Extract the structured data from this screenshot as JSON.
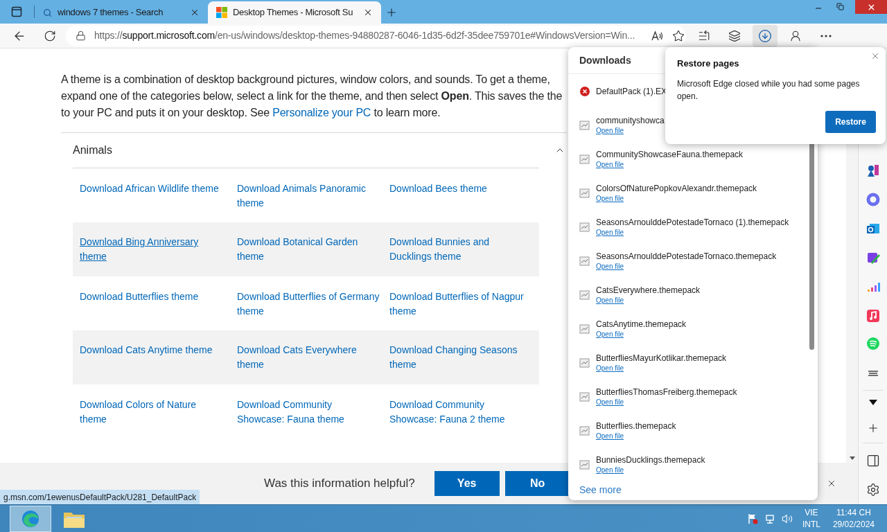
{
  "tabs": [
    {
      "title": "windows 7 themes - Search",
      "kind": "search",
      "selected": false
    },
    {
      "title": "Desktop Themes - Microsoft Su",
      "kind": "site",
      "selected": true
    }
  ],
  "address": {
    "scheme": "https://",
    "host": "support.microsoft.com",
    "path": "/en-us/windows/desktop-themes-94880287-6046-1d35-6d2f-35dee759701e#WindowsVersion=Win..."
  },
  "toolbar_buttons": [
    {
      "kind": "favorites",
      "selected": false
    },
    {
      "kind": "collections",
      "selected": false
    },
    {
      "kind": "downloads",
      "selected": true
    },
    {
      "kind": "profile",
      "selected": false
    },
    {
      "kind": "more",
      "selected": false
    }
  ],
  "intro": {
    "line_1": "A theme is a combination of desktop background pictures, window colors, and sounds. To get a theme,",
    "line_2": "expand one of the categories below, select a link for the theme, and then select **Open**. This saves the the",
    "line_3_start": "to your PC and puts it on your desktop. See",
    "link": "Personalize your PC",
    "line_3_end": "to learn more."
  },
  "category": {
    "title": "Animals",
    "expanded": true
  },
  "link_rows": [
    {
      "shaded": false,
      "links": [
        {
          "text": "Download African Wildlife theme",
          "hovered": false
        },
        {
          "text": "Download Animals Panoramic theme",
          "hovered": false
        },
        {
          "text": "Download Bees theme",
          "hovered": false
        }
      ]
    },
    {
      "shaded": true,
      "links": [
        {
          "text": "Download Bing Anniversary theme",
          "hovered": true
        },
        {
          "text": "Download Botanical Garden theme",
          "hovered": false
        },
        {
          "text": "Download Bunnies and Ducklings theme",
          "hovered": false
        }
      ]
    },
    {
      "shaded": false,
      "links": [
        {
          "text": "Download Butterflies theme",
          "hovered": false
        },
        {
          "text": "Download Butterflies of Germany theme",
          "hovered": false
        },
        {
          "text": "Download Butterflies of Nagpur theme",
          "hovered": false
        }
      ]
    },
    {
      "shaded": true,
      "links": [
        {
          "text": "Download Cats Anytime theme",
          "hovered": false
        },
        {
          "text": "Download Cats Everywhere theme",
          "hovered": false
        },
        {
          "text": "Download Changing Seasons theme",
          "hovered": false
        }
      ]
    },
    {
      "shaded": false,
      "links": [
        {
          "text": "Download Colors of Nature theme",
          "hovered": false
        },
        {
          "text": "Download Community Showcase: Fauna theme",
          "hovered": false
        },
        {
          "text": "Download Community Showcase: Fauna 2 theme",
          "hovered": false
        }
      ]
    }
  ],
  "feedback": {
    "question": "Was this information helpful?",
    "buttons": [
      "Yes",
      "No"
    ]
  },
  "status_url": "g.msn.com/1ewenusDefaultPack/U281_DefaultPack",
  "downloads": {
    "title": "Downloads",
    "items": [
      {
        "name": "DefaultPack (1).EX",
        "kind": "failed"
      },
      {
        "name": "communityshowca",
        "kind": "done",
        "action": "Open file"
      },
      {
        "name": "CommunityShowcaseFauna.themepack",
        "kind": "done",
        "action": "Open file"
      },
      {
        "name": "ColorsOfNaturePopkovAlexandr.themepack",
        "kind": "done",
        "action": "Open file"
      },
      {
        "name": "SeasonsArnoulddePotestadeTornaco (1).themepack",
        "kind": "done",
        "action": "Open file"
      },
      {
        "name": "SeasonsArnoulddePotestadeTornaco.themepack",
        "kind": "done",
        "action": "Open file"
      },
      {
        "name": "CatsEverywhere.themepack",
        "kind": "done",
        "action": "Open file"
      },
      {
        "name": "CatsAnytime.themepack",
        "kind": "done",
        "action": "Open file"
      },
      {
        "name": "ButterfliesMayurKotlikar.themepack",
        "kind": "done",
        "action": "Open file"
      },
      {
        "name": "ButterfliesThomasFreiberg.themepack",
        "kind": "done",
        "action": "Open file"
      },
      {
        "name": "Butterflies.themepack",
        "kind": "done",
        "action": "Open file"
      },
      {
        "name": "BunniesDucklings.themepack",
        "kind": "done",
        "action": "Open file"
      }
    ],
    "see_more": "See more"
  },
  "restore_popup": {
    "title": "Restore pages",
    "message": "Microsoft Edge closed while you had some pages open.",
    "button": "Restore"
  },
  "taskbar": {
    "language": "VIE",
    "layout": "INTL",
    "time": "11:44 CH",
    "date": "29/02/2024"
  }
}
